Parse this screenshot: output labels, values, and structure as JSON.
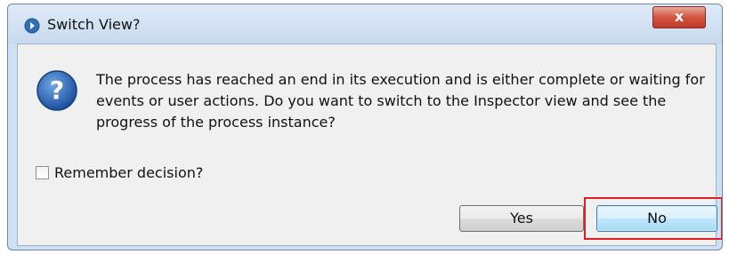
{
  "dialog": {
    "title": "Switch View?",
    "close_label": "x",
    "message": "The process has reached an end in its execution and is either complete or waiting for events or user actions. Do you want to switch to the Inspector view and see the progress of the process instance?",
    "remember_label": "Remember decision?",
    "remember_checked": false,
    "yes_label": "Yes",
    "no_label": "No"
  },
  "icons": {
    "title_icon": "info-arrow-icon",
    "message_icon": "question-icon"
  },
  "colors": {
    "highlight": "#e02020",
    "default_button_border": "#3c7fb1"
  }
}
